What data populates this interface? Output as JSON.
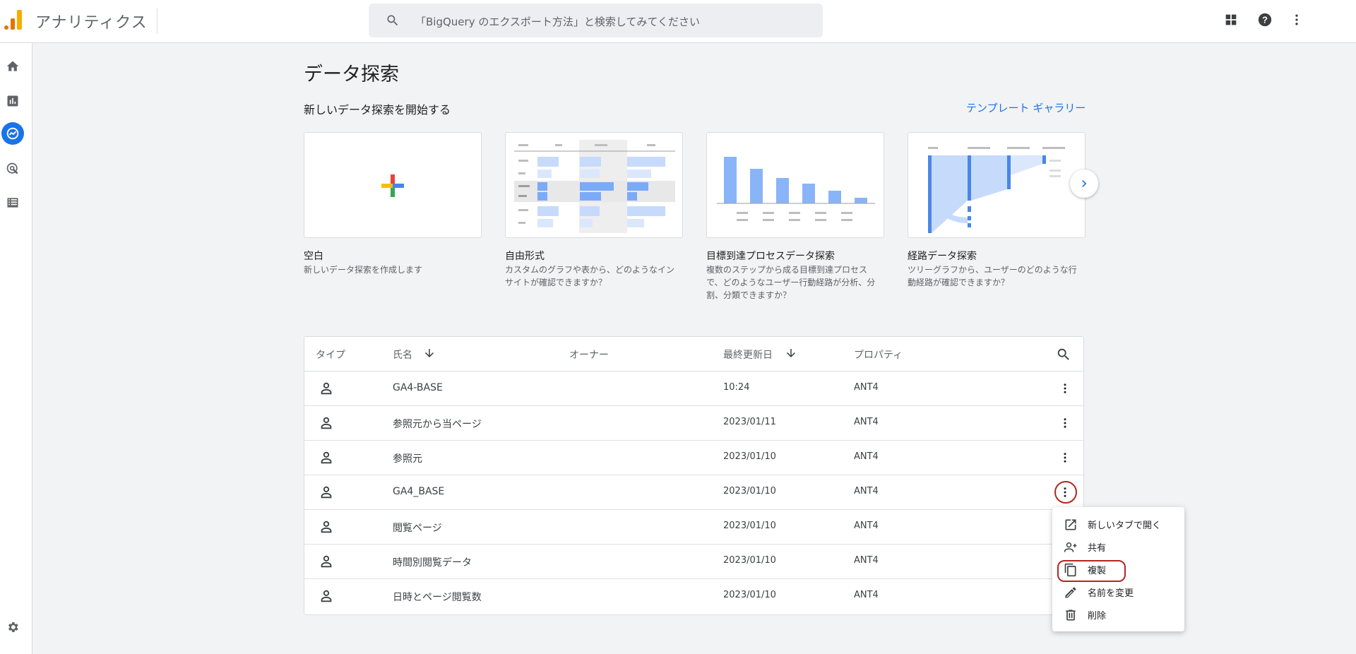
{
  "header": {
    "app_title": "アナリティクス",
    "search_placeholder": "「BigQuery のエクスポート方法」と検索してみてください"
  },
  "main": {
    "page_title": "データ探索",
    "subtitle": "新しいデータ探索を開始する",
    "gallery_link": "テンプレート ギャラリー",
    "cards": [
      {
        "name": "空白",
        "desc": "新しいデータ探索を作成します"
      },
      {
        "name": "自由形式",
        "desc": "カスタムのグラフや表から、どのようなインサイトが確認できますか？"
      },
      {
        "name": "目標到達プロセスデータ探索",
        "desc": "複数のステップから成る目標到達プロセスで、どのようなユーザー行動経路が分析、分割、分類できますか？"
      },
      {
        "name": "経路データ探索",
        "desc": "ツリーグラフから、ユーザーのどのような行動経路が確認できますか？"
      }
    ]
  },
  "table": {
    "headers": {
      "type": "タイプ",
      "name": "氏名",
      "owner": "オーナー",
      "modified": "最終更新日",
      "property": "プロパティ"
    },
    "rows": [
      {
        "name": "GA4-BASE",
        "modified": "10:24",
        "property": "ANT4"
      },
      {
        "name": "参照元から当ページ",
        "modified": "2023/01/11",
        "property": "ANT4"
      },
      {
        "name": "参照元",
        "modified": "2023/01/10",
        "property": "ANT4"
      },
      {
        "name": "GA4_BASE",
        "modified": "2023/01/10",
        "property": "ANT4"
      },
      {
        "name": "閲覧ページ",
        "modified": "2023/01/10",
        "property": "ANT4"
      },
      {
        "name": "時間別閲覧データ",
        "modified": "2023/01/10",
        "property": "ANT4"
      },
      {
        "name": "日時とページ閲覧数",
        "modified": "2023/01/10",
        "property": "ANT4"
      }
    ]
  },
  "context_menu": {
    "items": [
      {
        "label": "新しいタブで開く",
        "icon": "open-in-new-icon"
      },
      {
        "label": "共有",
        "icon": "share-person-icon"
      },
      {
        "label": "複製",
        "icon": "copy-icon"
      },
      {
        "label": "名前を変更",
        "icon": "pencil-icon"
      },
      {
        "label": "削除",
        "icon": "trash-icon"
      }
    ]
  },
  "colors": {
    "accent": "#1a73e8",
    "annotation": "#b3261e",
    "chart_blue": "#8ab4f8"
  }
}
